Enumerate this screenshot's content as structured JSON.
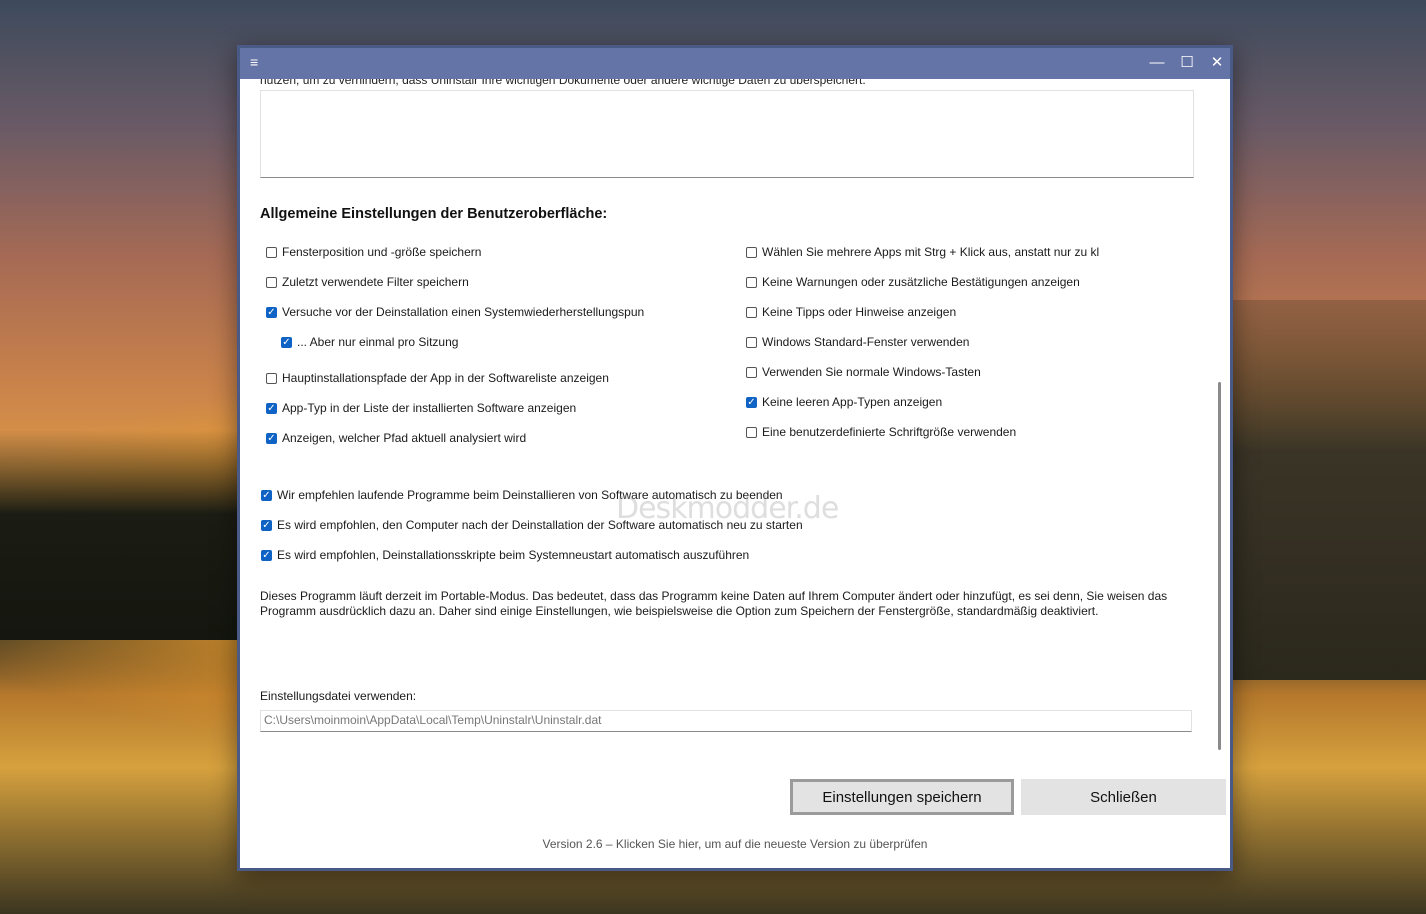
{
  "window": {
    "minimize_glyph": "—",
    "maximize_glyph": "☐",
    "close_glyph": "✕",
    "menu_glyph": "≡"
  },
  "top_cut_text": "nutzen, um zu verhindern, dass Uninstalr Ihre wichtigen Dokumente oder andere wichtige Daten zu überspeichert.",
  "section_title": "Allgemeine Einstellungen der Benutzeroberfläche:",
  "left_options": [
    {
      "label": "Fensterposition und -größe speichern",
      "checked": false
    },
    {
      "label": "Zuletzt verwendete Filter speichern",
      "checked": false
    },
    {
      "label": "Versuche vor der Deinstallation einen Systemwiederherstellungspun",
      "checked": true
    },
    {
      "label": "... Aber nur einmal pro Sitzung",
      "checked": true
    },
    {
      "label": "Hauptinstallationspfade der App in der Softwareliste anzeigen",
      "checked": false
    },
    {
      "label": "App-Typ in der Liste der installierten Software anzeigen",
      "checked": true
    },
    {
      "label": "Anzeigen, welcher Pfad aktuell analysiert wird",
      "checked": true
    }
  ],
  "right_options": [
    {
      "label": "Wählen Sie mehrere Apps mit Strg + Klick aus, anstatt nur zu kl",
      "checked": false
    },
    {
      "label": "Keine Warnungen oder zusätzliche Bestätigungen anzeigen",
      "checked": false
    },
    {
      "label": "Keine Tipps oder Hinweise anzeigen",
      "checked": false
    },
    {
      "label": "Windows Standard-Fenster verwenden",
      "checked": false
    },
    {
      "label": "Verwenden Sie normale Windows-Tasten",
      "checked": false
    },
    {
      "label": "Keine leeren App-Typen anzeigen",
      "checked": true
    },
    {
      "label": "Eine benutzerdefinierte Schriftgröße verwenden",
      "checked": false
    }
  ],
  "recommend_options": [
    {
      "label": "Wir empfehlen laufende Programme beim Deinstallieren von Software automatisch zu beenden",
      "checked": true
    },
    {
      "label": "Es wird empfohlen, den Computer nach der Deinstallation der Software automatisch neu zu starten",
      "checked": true
    },
    {
      "label": "Es wird empfohlen, Deinstallationsskripte beim Systemneustart automatisch auszuführen",
      "checked": true
    }
  ],
  "portable_info": "Dieses Programm läuft derzeit im Portable-Modus. Das bedeutet, dass das Programm keine Daten auf Ihrem Computer ändert oder hinzufügt, es sei denn, Sie weisen das Programm ausdrücklich dazu an. Daher sind einige Einstellungen, wie beispielsweise die Option zum Speichern der Fenstergröße, standardmäßig deaktiviert.",
  "settings_file": {
    "label": "Einstellungsdatei verwenden:",
    "value": "C:\\Users\\moinmoin\\AppData\\Local\\Temp\\Uninstalr\\Uninstalr.dat"
  },
  "buttons": {
    "save": "Einstellungen speichern",
    "close": "Schließen"
  },
  "version_text": "Version 2.6 – Klicken Sie hier, um auf die neueste Version zu überprüfen",
  "watermark": "Deskmodder.de",
  "colors": {
    "titlebar": "#6474a6",
    "window_border": "#4a5a86",
    "checkbox_accent": "#0f63c4"
  }
}
